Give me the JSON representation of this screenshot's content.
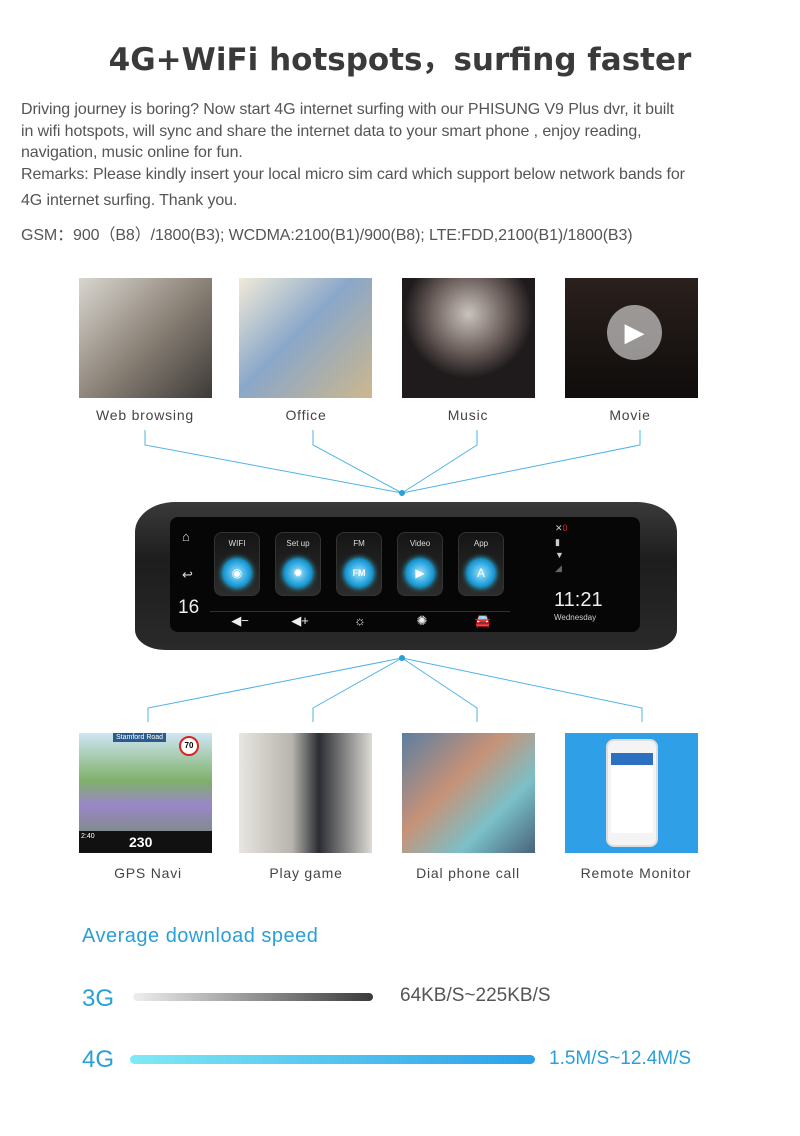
{
  "title": "4G+WiFi hotspots，surfing faster",
  "paragraph": [
    "Driving journey is boring? Now start 4G internet surfing with our PHISUNG V9 Plus dvr, it built",
    "in wifi hotspots, will sync and share the internet data to your smart phone , enjoy reading,",
    "navigation, music online for fun.",
    "Remarks: Please kindly insert your local micro sim card which support below network bands for",
    "4G internet surfing. Thank you.",
    "GSM：900（B8）/1800(B3); WCDMA:2100(B1)/900(B8); LTE:FDD,2100(B1)/1800(B3)"
  ],
  "top_features": [
    {
      "label": "Web browsing"
    },
    {
      "label": "Office"
    },
    {
      "label": "Music"
    },
    {
      "label": "Movie"
    }
  ],
  "bottom_features": [
    {
      "label": "GPS Navi"
    },
    {
      "label": "Play game"
    },
    {
      "label": "Dial phone call"
    },
    {
      "label": "Remote Monitor"
    }
  ],
  "device": {
    "apps": [
      {
        "label": "WIFI",
        "icon": "wifi-icon"
      },
      {
        "label": "Set up",
        "icon": "gear-icon"
      },
      {
        "label": "FM",
        "icon": "fm-radio-icon",
        "glyph": "FM"
      },
      {
        "label": "Video",
        "icon": "play-icon"
      },
      {
        "label": "App",
        "icon": "app-store-icon"
      }
    ],
    "temp": "16",
    "time": "11:21",
    "day": "Wednesday",
    "gps_sat": "0"
  },
  "gps_overlay": {
    "road": "Stamford Road",
    "speed_limit": "70",
    "distance": "230",
    "time": "2:40"
  },
  "speed": {
    "heading": "Average download speed",
    "rows": [
      {
        "label": "3G",
        "range": "64KB/S~225KB/S"
      },
      {
        "label": "4G",
        "range": "1.5M/S~12.4M/S"
      }
    ]
  },
  "colors": {
    "accent": "#2a9fd8",
    "line": "#4fb3e8"
  }
}
